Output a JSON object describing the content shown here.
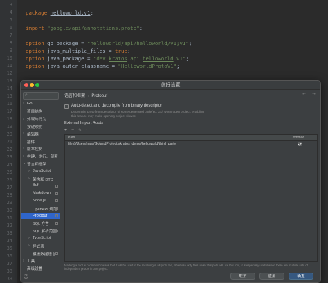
{
  "editor": {
    "line_numbers": [
      "3",
      "4",
      "5",
      "6",
      "7",
      "8",
      "9",
      "10",
      "11",
      "12",
      "13",
      "14",
      "15",
      "16",
      "17",
      "18",
      "19",
      "20",
      "21",
      "22",
      "23",
      "24",
      "25",
      "26",
      "27",
      "28",
      "29",
      "30",
      "31",
      "32",
      "33",
      "34",
      "35",
      "36",
      "37",
      "38",
      "39"
    ],
    "code": {
      "package_kw": "package",
      "package_name": "helloworld.v1",
      "package_semi": ";",
      "import_kw": "import",
      "import_path": "\"google/api/annotations.proto\"",
      "import_semi": ";",
      "opt1_kw": "option",
      "opt1_name": " go_package = ",
      "opt1_val_a": "\"",
      "opt1_val_u": "helloworld",
      "opt1_val_b": "/api/",
      "opt1_val_u2": "helloworld",
      "opt1_val_c": "/v1;v1\"",
      "opt1_semi": ";",
      "opt2_kw": "option",
      "opt2_name": " java_multiple_files = ",
      "opt2_val": "true",
      "opt2_semi": ";",
      "opt3_kw": "option",
      "opt3_name": " java_package = ",
      "opt3_val_a": "\"dev.",
      "opt3_val_u": "kratos",
      "opt3_val_b": ".api.",
      "opt3_val_u2": "helloworld",
      "opt3_val_c": ".v1\"",
      "opt3_semi": ";",
      "opt4_kw": "option",
      "opt4_name": " java_outer_classname = ",
      "opt4_val_a": "\"",
      "opt4_val_u": "HelloworldProtoV1",
      "opt4_val_b": "\"",
      "opt4_semi": ";"
    }
  },
  "dialog": {
    "title": "偏好设置",
    "search_icon": "search-icon",
    "sidebar": [
      {
        "label": "Go",
        "arrow": "›",
        "indent": 0
      },
      {
        "label": "项目结构",
        "arrow": "",
        "indent": 0
      },
      {
        "label": "外观与行为",
        "arrow": "›",
        "indent": 0
      },
      {
        "label": "按键映射",
        "arrow": "",
        "indent": 0
      },
      {
        "label": "编辑器",
        "arrow": "›",
        "indent": 0
      },
      {
        "label": "插件",
        "arrow": "",
        "indent": 0
      },
      {
        "label": "版本控制",
        "arrow": "›",
        "indent": 0
      },
      {
        "label": "构建、执行、部署",
        "arrow": "›",
        "indent": 0
      },
      {
        "label": "语言和框架",
        "arrow": "⌄",
        "indent": 0
      },
      {
        "label": "JavaScript",
        "arrow": "›",
        "indent": 1
      },
      {
        "label": "架构和 DTD",
        "arrow": "›",
        "indent": 1
      },
      {
        "label": "Buf",
        "arrow": "",
        "indent": 1
      },
      {
        "label": "Markdown",
        "arrow": "",
        "indent": 1
      },
      {
        "label": "Node.js",
        "arrow": "",
        "indent": 1
      },
      {
        "label": "OpenAPI 规范",
        "arrow": "",
        "indent": 1
      },
      {
        "label": "Protobuf",
        "arrow": "",
        "indent": 1,
        "selected": true
      },
      {
        "label": "SQL 方言",
        "arrow": "",
        "indent": 1
      },
      {
        "label": "SQL 解析范围",
        "arrow": "",
        "indent": 1
      },
      {
        "label": "TypeScript",
        "arrow": "›",
        "indent": 1
      },
      {
        "label": "样式表",
        "arrow": "›",
        "indent": 1
      },
      {
        "label": "模板数据语言",
        "arrow": "",
        "indent": 1
      },
      {
        "label": "工具",
        "arrow": "›",
        "indent": 0
      },
      {
        "label": "高级设置",
        "arrow": "",
        "indent": 0
      }
    ],
    "breadcrumb": {
      "parent": "语言和框架",
      "sep": "›",
      "current": "Protobuf"
    },
    "nav_back": "←",
    "nav_forward": "→",
    "auto_detect_label": "Auto-detect and decompile from binary descriptor",
    "auto_detect_checked": false,
    "auto_detect_desc": "Decompile proto from descriptor of some generated code(eg, Go) when open project, enabling this feature may make opening project slower.",
    "section_title": "External Import Roots",
    "toolbar": {
      "add": "+",
      "remove": "−",
      "edit": "✎",
      "up": "↑",
      "down": "↓"
    },
    "table": {
      "col_path": "Path",
      "col_common": "Common",
      "rows": [
        {
          "path": "file:///Users/mac/GolandProjects/kratos_demo/helloworld/third_party",
          "common": true
        }
      ]
    },
    "note": "Marking a root as 'common' means that it will be used in the resolving in all proto file, otherwise only files under this path will use this root, it is especially useful when there are multiple sets of independent protos in one project.",
    "buttons": {
      "cancel": "取消",
      "apply": "应用",
      "ok": "确定"
    },
    "help": "?"
  }
}
